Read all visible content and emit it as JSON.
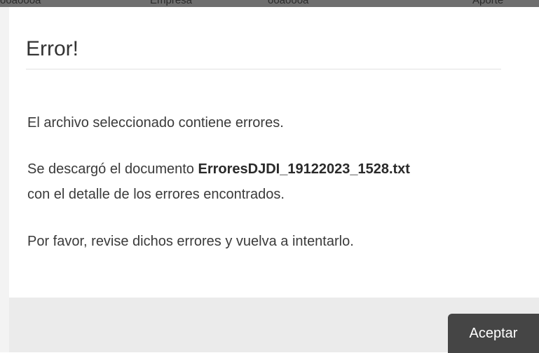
{
  "backdrop": {
    "fragments": [
      "ooaoooa",
      "Empresa",
      "ooaoooa",
      "Aporte"
    ]
  },
  "modal": {
    "title": "Error!",
    "message1": "El archivo seleccionado contiene errores.",
    "message2_prefix": "Se descargó el documento ",
    "filename": "ErroresDJDI_19122023_1528.txt",
    "message2_suffix": "con el detalle de los errores encontrados.",
    "message3": "Por favor, revise dichos errores y vuelva a intentarlo.",
    "accept_label": "Aceptar"
  },
  "colors": {
    "button_bg": "#454545",
    "footer_bg": "#ebebeb",
    "title_color": "#333333"
  }
}
